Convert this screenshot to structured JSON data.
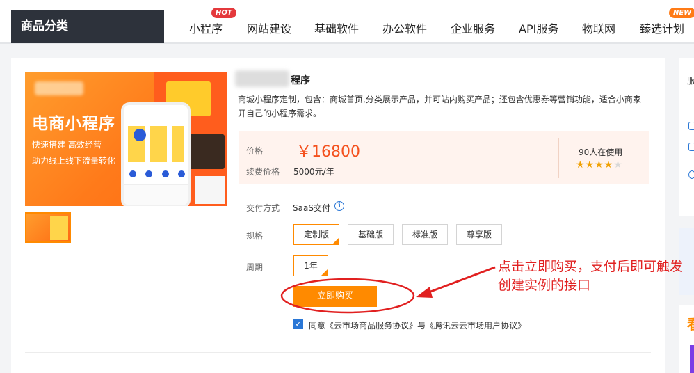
{
  "nav": {
    "category_label": "商品分类",
    "items": [
      {
        "label": "小程序",
        "badge": "HOT"
      },
      {
        "label": "网站建设"
      },
      {
        "label": "基础软件"
      },
      {
        "label": "办公软件"
      },
      {
        "label": "企业服务"
      },
      {
        "label": "API服务"
      },
      {
        "label": "物联网"
      },
      {
        "label": "臻选计划",
        "badge": "NEW"
      }
    ]
  },
  "product": {
    "image": {
      "title": "电商小程序",
      "sub1": "快速搭建    高效经营",
      "sub2": "助力线上线下流量转化"
    },
    "title": "程序",
    "description": "商城小程序定制，包含：商城首页,分类展示产品，并可站内购买产品；还包含优惠券等营销功能，适合小商家开自己的小程序需求。",
    "price_label": "价格",
    "price": "￥16800",
    "renew_label": "续费价格",
    "renew_value": "5000元/年",
    "users": "90人在使用",
    "rating": 4.5,
    "delivery_label": "交付方式",
    "delivery_value": "SaaS交付",
    "spec_label": "规格",
    "specs": [
      {
        "label": "定制版",
        "selected": true
      },
      {
        "label": "基础版",
        "selected": false
      },
      {
        "label": "标准版",
        "selected": false
      },
      {
        "label": "尊享版",
        "selected": false
      }
    ],
    "period_label": "周期",
    "period_value": "1年",
    "buy_label": "立即购买",
    "agree_text": "同意《云市场商品服务协议》与《腾讯云云市场用户协议》"
  },
  "annotation": {
    "text": "点击立即购买，支付后即可触发创建实例的接口",
    "color": "#e12020"
  },
  "colors": {
    "accent": "#ff8a00",
    "price": "#f4511e",
    "nav_dark": "#2d323b",
    "link_blue": "#2a77d6"
  }
}
